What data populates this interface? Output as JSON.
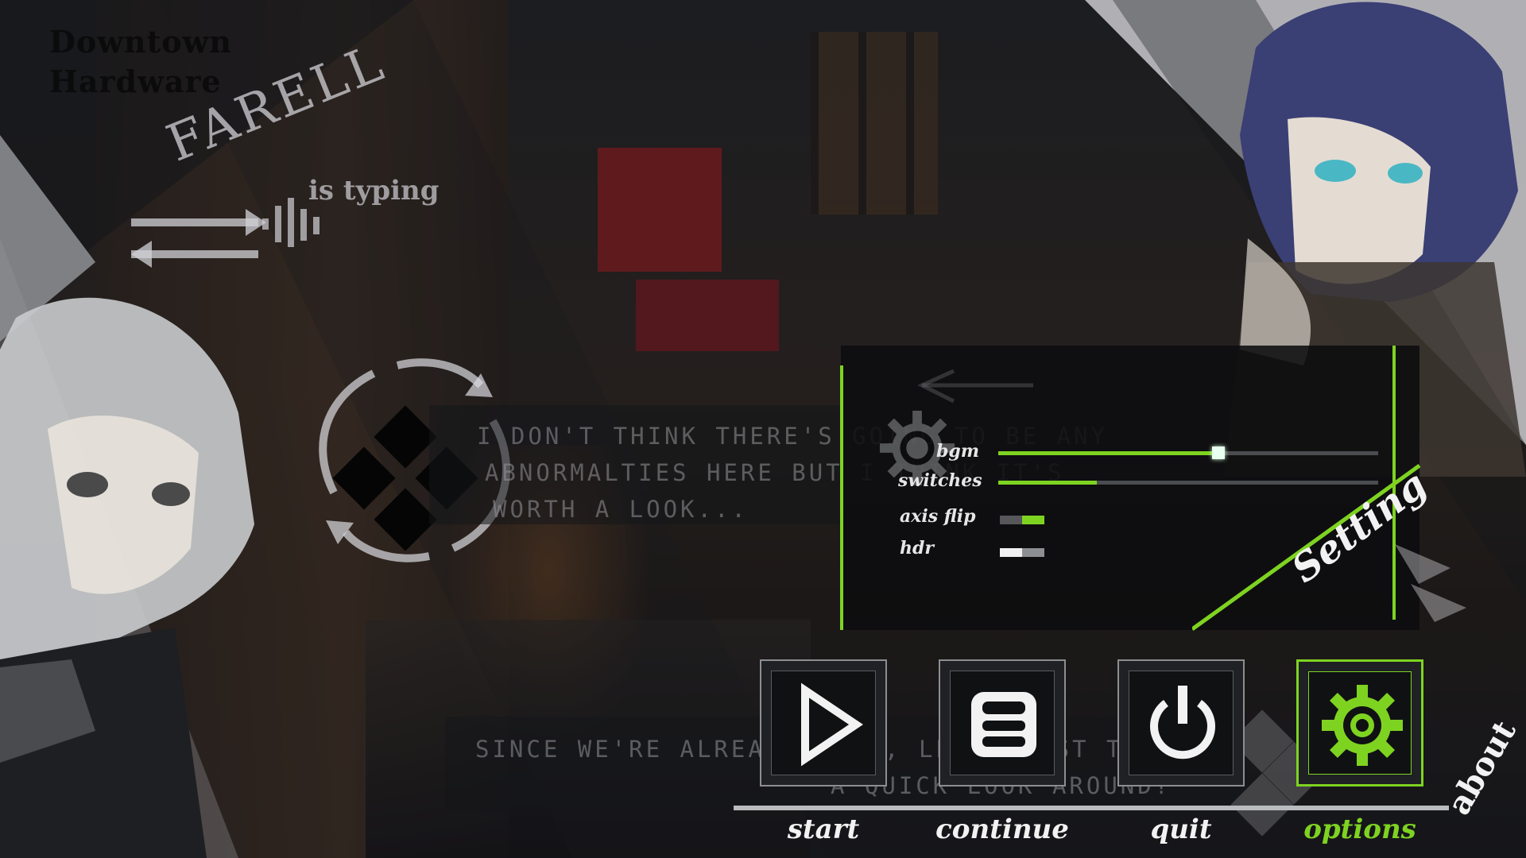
{
  "brand": {
    "line1": "Downtown",
    "line2": "Hardware"
  },
  "speaker": {
    "name": "FARELL",
    "status": "is typing"
  },
  "dialog": {
    "top_lines": [
      "I DON'T THINK THERE'S GOING TO BE ANY",
      "ABNORMALTIES HERE BUT I THINK IT'S",
      "WORTH A LOOK..."
    ],
    "bottom_lines": [
      "SINCE WE'RE ALREADY HERE, LET'S JUST TAKE",
      "A QUICK LOOK AROUND?"
    ]
  },
  "settings": {
    "title": "Setting",
    "bgm": {
      "label": "bgm",
      "value": 0.58
    },
    "switches": {
      "label": "switches",
      "value": 0.26
    },
    "axis_flip": {
      "label": "axis flip",
      "on": true
    },
    "hdr": {
      "label": "hdr",
      "on": false
    }
  },
  "menu": {
    "start": "start",
    "continue": "continue",
    "quit": "quit",
    "options": "options",
    "about": "about"
  },
  "colors": {
    "accent": "#7ed321",
    "panel": "#0c0d0f",
    "text": "#f2f2f2"
  },
  "icons": [
    "play-icon",
    "save-icon",
    "power-icon",
    "gear-icon"
  ]
}
